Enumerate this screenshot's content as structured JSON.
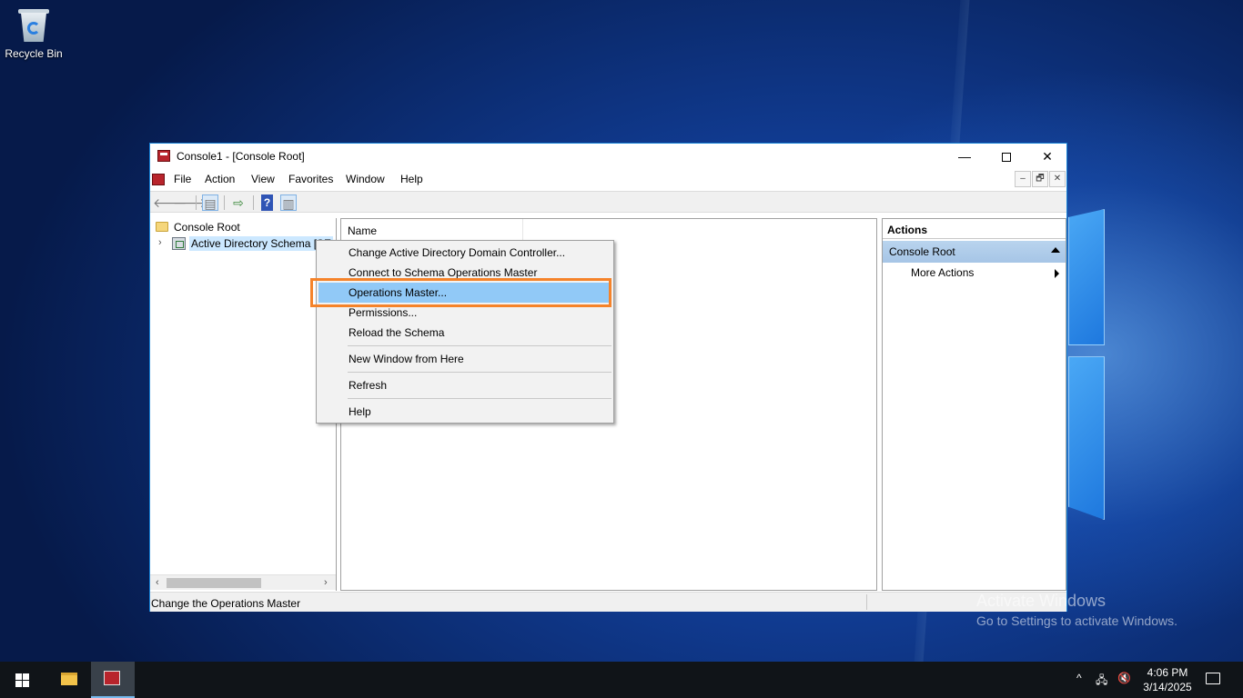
{
  "desktop": {
    "recycle_bin_label": "Recycle Bin",
    "watermark_line1": "Activate Windows",
    "watermark_line2": "Go to Settings to activate Windows."
  },
  "window": {
    "title": "Console1 - [Console Root]",
    "controls": {
      "minimize": "—",
      "close": "✕"
    },
    "menu": [
      "File",
      "Action",
      "View",
      "Favorites",
      "Window",
      "Help"
    ],
    "mdi_controls": [
      "–",
      "🗗",
      "✕"
    ]
  },
  "toolbar": {
    "back_icon": "back-arrow-icon",
    "forward_icon": "forward-arrow-icon",
    "help_label": "?"
  },
  "tree": {
    "root": "Console Root",
    "child": "Active Directory Schema [SE"
  },
  "center": {
    "column_name": "Name"
  },
  "actions": {
    "header": "Actions",
    "section": "Console Root",
    "more": "More Actions"
  },
  "status": {
    "text": "Change the Operations Master"
  },
  "context_menu": {
    "items": [
      "Change Active Directory Domain Controller...",
      "Connect to Schema Operations Master",
      "Operations Master...",
      "Permissions...",
      "Reload the Schema",
      "New Window from Here",
      "Refresh",
      "Help"
    ],
    "highlighted_index": 2,
    "highlight_color": "#f5832a"
  },
  "taskbar": {
    "time": "4:06 PM",
    "date": "3/14/2025",
    "tray_chevron": "^"
  }
}
